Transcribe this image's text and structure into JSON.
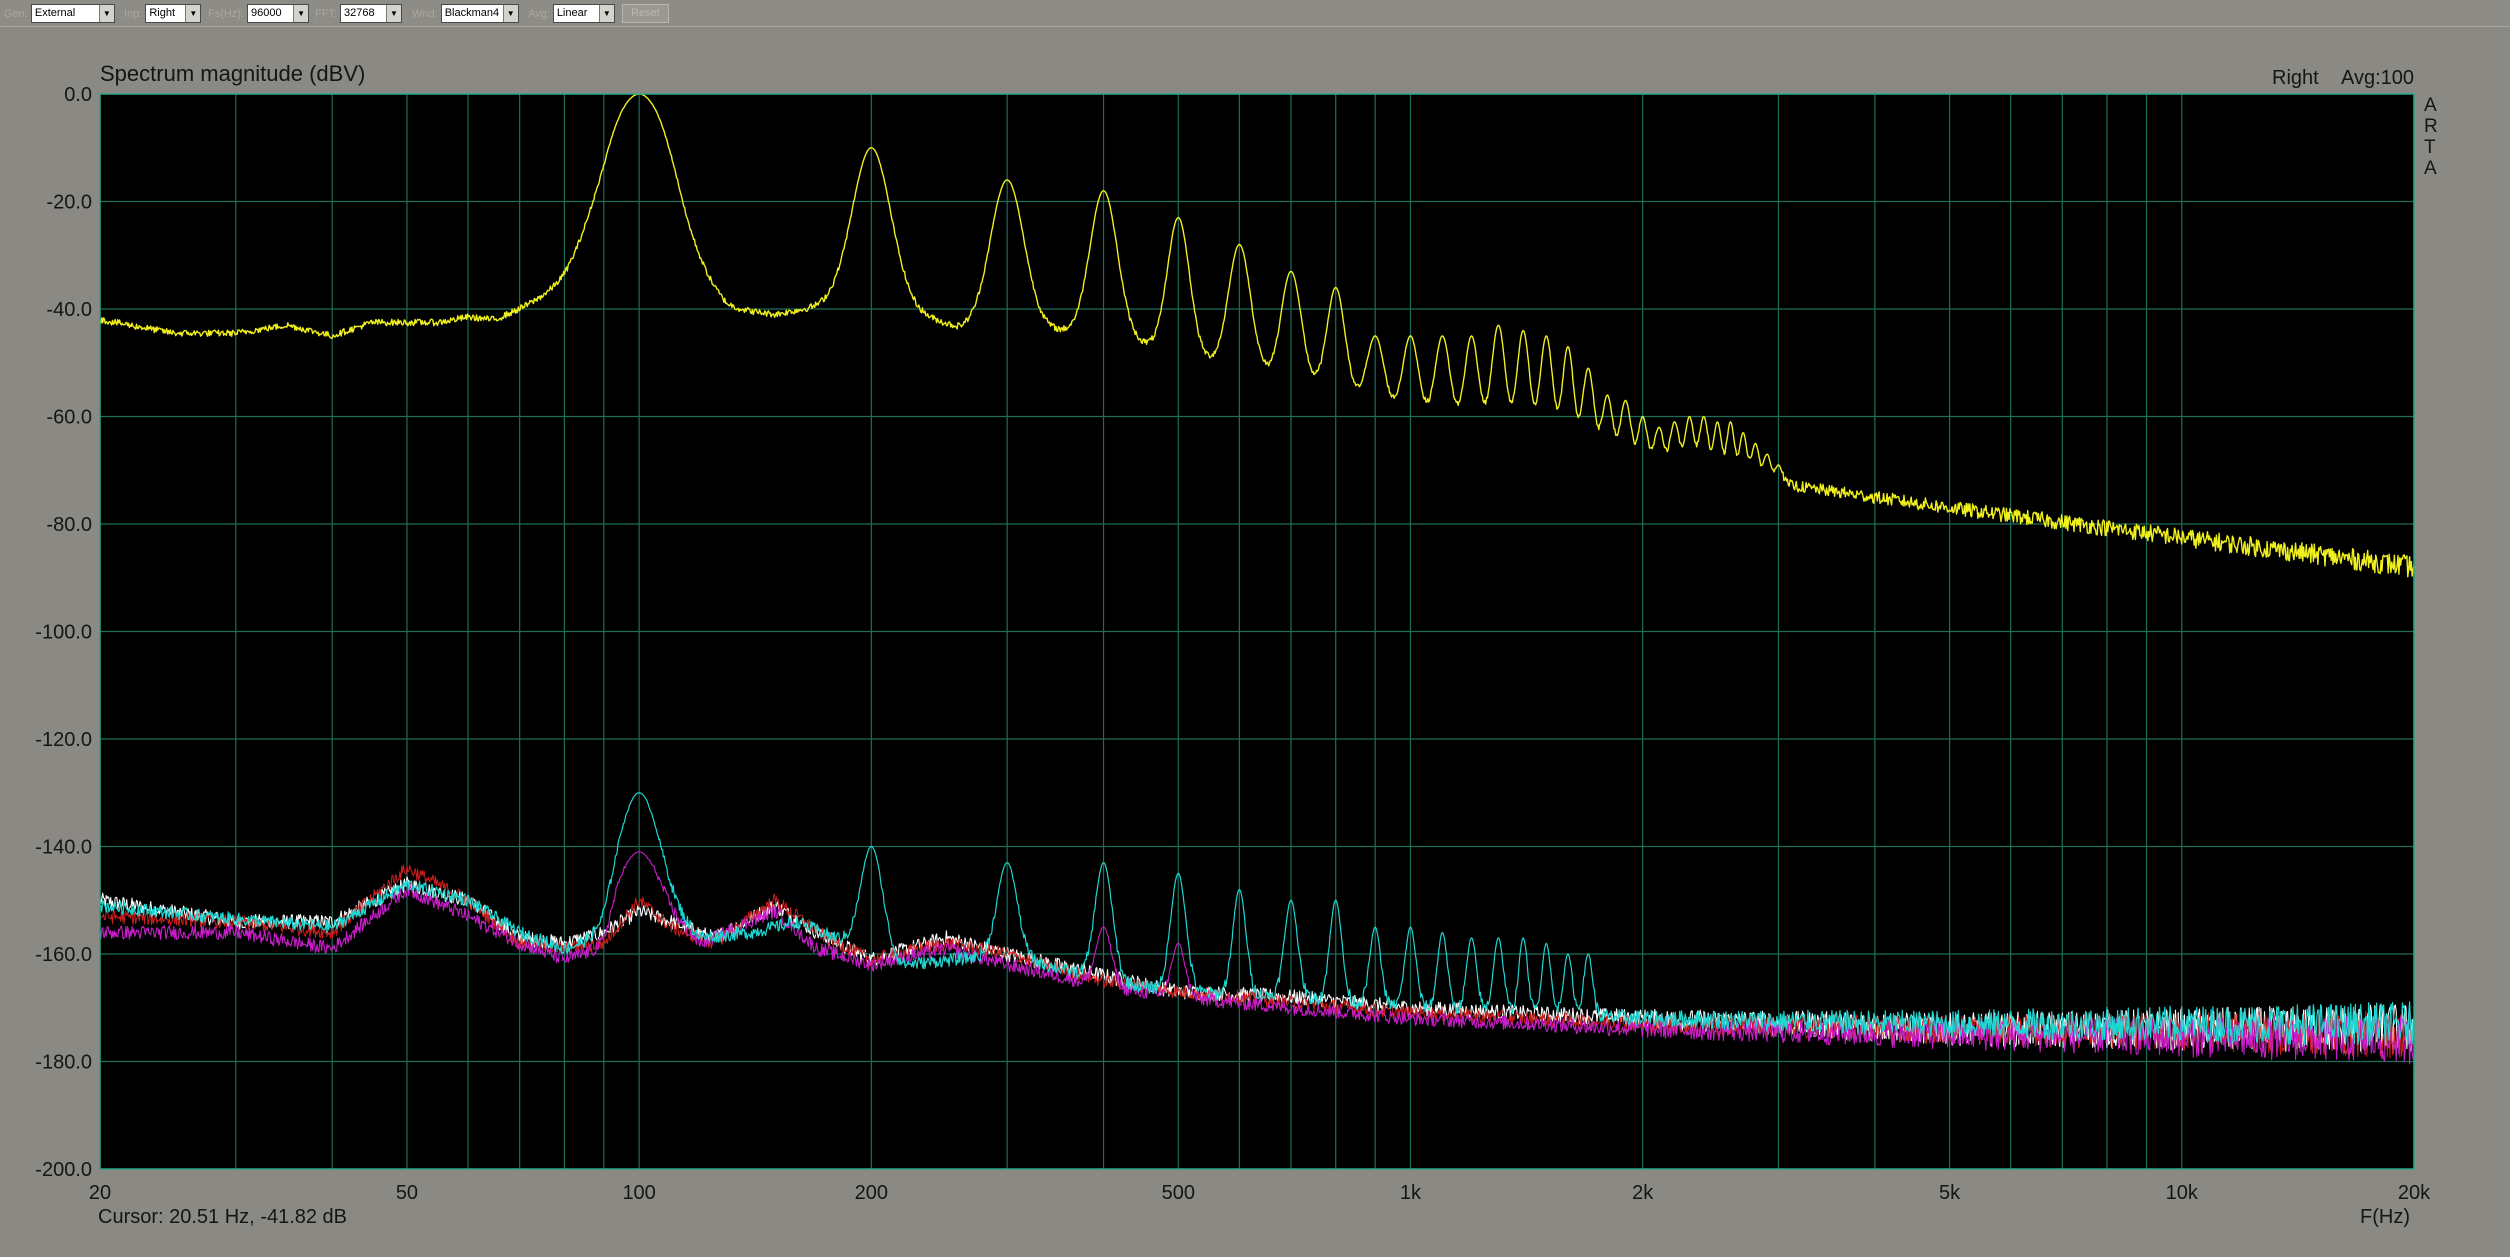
{
  "toolbar": {
    "items": [
      {
        "label": "Gen:",
        "value": "External"
      },
      {
        "label": "Inp:",
        "value": "Right"
      },
      {
        "label": "Fs(Hz):",
        "value": "96000"
      },
      {
        "label": "FFT:",
        "value": "32768"
      },
      {
        "label": "Wnd:",
        "value": "Blackman4"
      },
      {
        "label": "Avg:",
        "value": "Linear"
      }
    ],
    "reset_label": "Reset"
  },
  "colors": {
    "plot_background": "#000000",
    "grid": "#1c6e5a",
    "frame": "#2aa88a",
    "series_main": "#f0f01e",
    "noise_cyan": "#1ed7d2",
    "noise_white": "#ffffff",
    "noise_red": "#cc1e1e",
    "noise_magenta": "#c81ec8"
  },
  "status": {
    "channel": "Right",
    "avg": "Avg:100",
    "logo": "A R T A",
    "cursor": "Cursor: 20.51 Hz, -41.82 dB"
  },
  "chart_data": {
    "type": "line",
    "title": "Spectrum magnitude (dBV)",
    "xlabel": "F(Hz)",
    "ylabel": "",
    "x_scale": "log",
    "xlim": [
      20,
      20000
    ],
    "ylim": [
      -200,
      0
    ],
    "x_ticks": [
      20,
      50,
      100,
      200,
      500,
      1000,
      2000,
      5000,
      10000,
      20000
    ],
    "x_tick_labels": [
      "20",
      "50",
      "100",
      "200",
      "500",
      "1k",
      "2k",
      "5k",
      "10k",
      "20k"
    ],
    "y_ticks": [
      0,
      -20,
      -40,
      -60,
      -80,
      -100,
      -120,
      -140,
      -160,
      -180,
      -200
    ],
    "y_tick_labels": [
      "0.0",
      "-20.0",
      "-40.0",
      "-60.0",
      "-80.0",
      "-100.0",
      "-120.0",
      "-140.0",
      "-160.0",
      "-180.0",
      "-200.0"
    ],
    "grid": true,
    "series": [
      {
        "color": "#f0f01e",
        "baseline": [
          [
            20,
            -42
          ],
          [
            25,
            -44.5
          ],
          [
            30,
            -44.5
          ],
          [
            35,
            -43
          ],
          [
            40,
            -45
          ],
          [
            45,
            -42.5
          ],
          [
            55,
            -42.5
          ],
          [
            60,
            -41.5
          ],
          [
            65,
            -42
          ],
          [
            70,
            -40
          ],
          [
            80,
            -36
          ],
          [
            90,
            -30
          ],
          [
            95,
            -24
          ],
          [
            105,
            -25
          ],
          [
            115,
            -35
          ],
          [
            130,
            -40
          ],
          [
            150,
            -41
          ],
          [
            180,
            -39
          ],
          [
            220,
            -40
          ],
          [
            260,
            -43.5
          ],
          [
            300,
            -42.5
          ],
          [
            350,
            -44
          ],
          [
            400,
            -45
          ],
          [
            450,
            -46.5
          ],
          [
            500,
            -48
          ],
          [
            600,
            -51
          ],
          [
            700,
            -53
          ],
          [
            800,
            -55
          ],
          [
            900,
            -57.5
          ],
          [
            1000,
            -59.5
          ],
          [
            1200,
            -61
          ],
          [
            1500,
            -63.5
          ],
          [
            2000,
            -68
          ],
          [
            3000,
            -72.5
          ],
          [
            5000,
            -77
          ],
          [
            10000,
            -82.5
          ],
          [
            20000,
            -88
          ]
        ],
        "peaks": [
          [
            100,
            0,
            0.06
          ],
          [
            200,
            -10,
            0.035
          ],
          [
            300,
            -16,
            0.03
          ],
          [
            400,
            -18,
            0.025
          ],
          [
            500,
            -23,
            0.02
          ],
          [
            600,
            -28,
            0.02
          ],
          [
            700,
            -33,
            0.018
          ],
          [
            800,
            -36,
            0.016
          ],
          [
            900,
            -45,
            0.015
          ],
          [
            1000,
            -45,
            0.014
          ],
          [
            1100,
            -45,
            0.013
          ],
          [
            1200,
            -45,
            0.012
          ],
          [
            1300,
            -43,
            0.012
          ],
          [
            1400,
            -44,
            0.011
          ],
          [
            1500,
            -45,
            0.011
          ],
          [
            1600,
            -47,
            0.01
          ],
          [
            1700,
            -51,
            0.01
          ],
          [
            1800,
            -56,
            0.009
          ],
          [
            1900,
            -57,
            0.009
          ],
          [
            2000,
            -60,
            0.008
          ],
          [
            2100,
            -62,
            0.008
          ],
          [
            2200,
            -61,
            0.008
          ],
          [
            2300,
            -60,
            0.008
          ],
          [
            2400,
            -60,
            0.008
          ],
          [
            2500,
            -61,
            0.007
          ],
          [
            2600,
            -61,
            0.007
          ],
          [
            2700,
            -63,
            0.007
          ],
          [
            2800,
            -65,
            0.007
          ],
          [
            2900,
            -67,
            0.007
          ],
          [
            3000,
            -69,
            0.007
          ]
        ],
        "noise": 0.6,
        "thickness": 1.4
      },
      {
        "color": "#1ed7d2",
        "baseline": [
          [
            20,
            -151
          ],
          [
            30,
            -153.5
          ],
          [
            40,
            -155
          ],
          [
            50,
            -147
          ],
          [
            60,
            -150
          ],
          [
            70,
            -156
          ],
          [
            80,
            -159
          ],
          [
            90,
            -157
          ],
          [
            95,
            -150
          ],
          [
            105,
            -150
          ],
          [
            120,
            -157
          ],
          [
            140,
            -156
          ],
          [
            160,
            -154
          ],
          [
            180,
            -157
          ],
          [
            220,
            -162
          ],
          [
            300,
            -160
          ],
          [
            400,
            -165
          ],
          [
            500,
            -167
          ],
          [
            700,
            -168
          ],
          [
            1000,
            -170
          ],
          [
            2000,
            -172
          ],
          [
            5000,
            -173
          ],
          [
            20000,
            -173
          ]
        ],
        "peaks": [
          [
            100,
            -130,
            0.035
          ],
          [
            200,
            -140,
            0.02
          ],
          [
            300,
            -143,
            0.018
          ],
          [
            400,
            -143,
            0.016
          ],
          [
            500,
            -145,
            0.014
          ],
          [
            600,
            -148,
            0.012
          ],
          [
            700,
            -150,
            0.012
          ],
          [
            800,
            -150,
            0.011
          ],
          [
            900,
            -155,
            0.01
          ],
          [
            1000,
            -155,
            0.01
          ],
          [
            1100,
            -156,
            0.009
          ],
          [
            1200,
            -157,
            0.009
          ],
          [
            1300,
            -157,
            0.009
          ],
          [
            1400,
            -157,
            0.008
          ],
          [
            1500,
            -158,
            0.008
          ],
          [
            1600,
            -160,
            0.008
          ],
          [
            1700,
            -160,
            0.008
          ]
        ],
        "noise": 1.2,
        "thickness": 1.2
      },
      {
        "color": "#ffffff",
        "baseline": [
          [
            20,
            -150
          ],
          [
            30,
            -154
          ],
          [
            40,
            -154
          ],
          [
            50,
            -147
          ],
          [
            60,
            -150
          ],
          [
            70,
            -157
          ],
          [
            80,
            -158
          ],
          [
            90,
            -156
          ],
          [
            100,
            -152
          ],
          [
            110,
            -154
          ],
          [
            125,
            -157
          ],
          [
            150,
            -151
          ],
          [
            170,
            -156
          ],
          [
            200,
            -161
          ],
          [
            250,
            -157
          ],
          [
            300,
            -160
          ],
          [
            400,
            -164
          ],
          [
            500,
            -167
          ],
          [
            700,
            -168
          ],
          [
            1000,
            -170
          ],
          [
            2000,
            -172
          ],
          [
            5000,
            -174
          ],
          [
            20000,
            -174
          ]
        ],
        "peaks": [],
        "noise": 1.4,
        "thickness": 1.1
      },
      {
        "color": "#cc1e1e",
        "baseline": [
          [
            20,
            -153
          ],
          [
            30,
            -154
          ],
          [
            40,
            -156
          ],
          [
            50,
            -144
          ],
          [
            60,
            -150
          ],
          [
            70,
            -158
          ],
          [
            80,
            -159
          ],
          [
            90,
            -158
          ],
          [
            100,
            -150
          ],
          [
            110,
            -155
          ],
          [
            125,
            -158
          ],
          [
            150,
            -150
          ],
          [
            175,
            -157
          ],
          [
            200,
            -161
          ],
          [
            250,
            -158
          ],
          [
            300,
            -160
          ],
          [
            400,
            -165
          ],
          [
            500,
            -167
          ],
          [
            700,
            -169
          ],
          [
            1000,
            -171
          ],
          [
            2000,
            -173
          ],
          [
            5000,
            -174
          ],
          [
            20000,
            -175
          ]
        ],
        "peaks": [],
        "noise": 1.3,
        "thickness": 1.0
      },
      {
        "color": "#c81ec8",
        "baseline": [
          [
            20,
            -156
          ],
          [
            30,
            -156
          ],
          [
            40,
            -159
          ],
          [
            50,
            -148
          ],
          [
            60,
            -153
          ],
          [
            70,
            -158
          ],
          [
            80,
            -161
          ],
          [
            90,
            -159
          ],
          [
            95,
            -150
          ],
          [
            105,
            -150
          ],
          [
            120,
            -158
          ],
          [
            150,
            -152
          ],
          [
            170,
            -159
          ],
          [
            200,
            -162
          ],
          [
            250,
            -159
          ],
          [
            300,
            -162
          ],
          [
            400,
            -166
          ],
          [
            500,
            -168
          ],
          [
            700,
            -170
          ],
          [
            1000,
            -172
          ],
          [
            2000,
            -174
          ],
          [
            5000,
            -175
          ],
          [
            20000,
            -176
          ]
        ],
        "peaks": [
          [
            100,
            -141,
            0.03
          ],
          [
            400,
            -155,
            0.014
          ],
          [
            500,
            -158,
            0.012
          ]
        ],
        "noise": 1.3,
        "thickness": 1.1
      }
    ]
  }
}
